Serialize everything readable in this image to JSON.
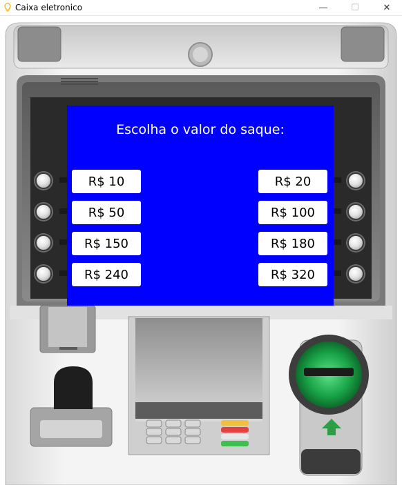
{
  "window": {
    "title": "Caixa eletronico",
    "minimize_glyph": "—",
    "maximize_glyph": "☐",
    "close_glyph": "✕",
    "icon": "lightbulb-icon"
  },
  "screen": {
    "title": "Escolha o valor do saque:",
    "background": "#0000ff",
    "left_options": [
      "R$ 10",
      "R$ 50",
      "R$ 150",
      "R$ 240"
    ],
    "right_options": [
      "R$ 20",
      "R$ 100",
      "R$ 180",
      "R$ 320"
    ]
  },
  "colors": {
    "card_slot_green": "#19a34a",
    "arrow_green": "#2e9e46"
  }
}
